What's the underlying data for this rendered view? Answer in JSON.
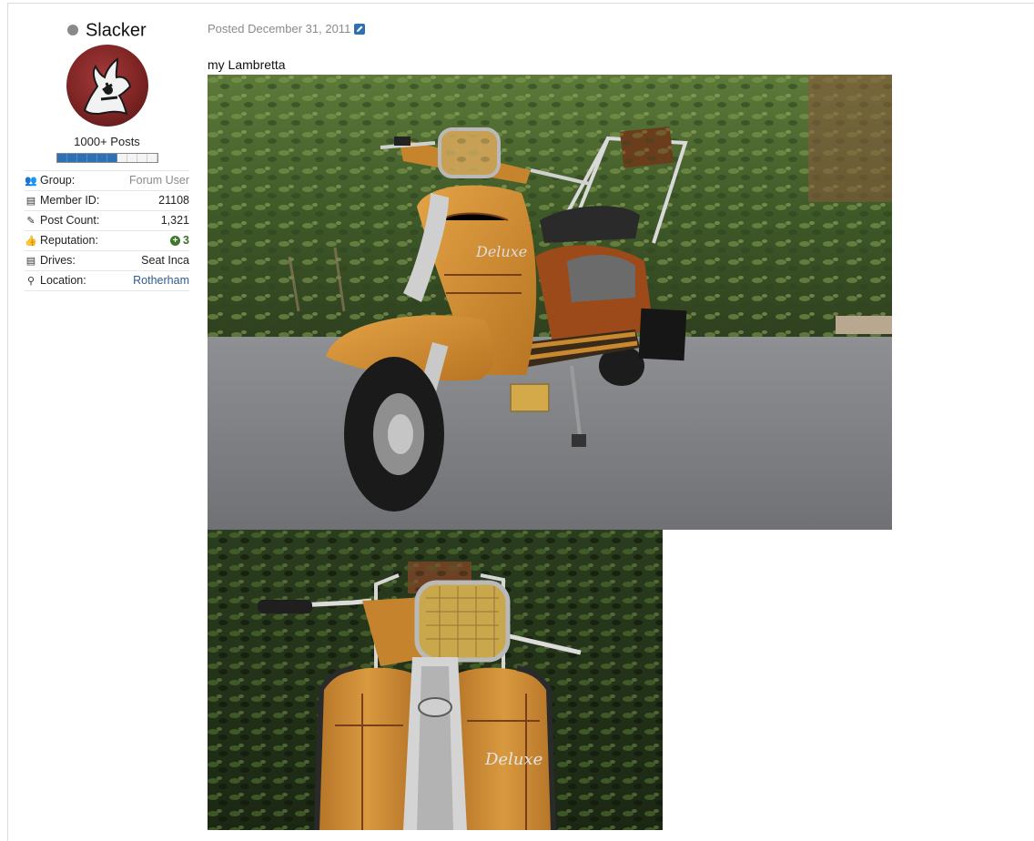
{
  "author": {
    "name": "Slacker",
    "status": "offline",
    "rank_label": "1000+ Posts",
    "rank_progress": 0.6,
    "info": [
      {
        "icon": "users-icon",
        "glyph": "👥",
        "key": "Group:",
        "value": "Forum User",
        "style": "muted"
      },
      {
        "icon": "id-card-icon",
        "glyph": "▤",
        "key": "Member ID:",
        "value": "21108",
        "style": "plain"
      },
      {
        "icon": "edit-icon",
        "glyph": "✎",
        "key": "Post Count:",
        "value": "1,321",
        "style": "plain"
      },
      {
        "icon": "thumbs-up-icon",
        "glyph": "👍",
        "key": "Reputation:",
        "value": "3",
        "style": "rep"
      },
      {
        "icon": "id-card-icon",
        "glyph": "▤",
        "key": "Drives:",
        "value": "Seat Inca",
        "style": "plain"
      },
      {
        "icon": "map-marker-icon",
        "glyph": "⚲",
        "key": "Location:",
        "value": "Rotherham",
        "style": "link"
      }
    ]
  },
  "post": {
    "date": "Posted December 31, 2011",
    "text": "my Lambretta",
    "images": [
      {
        "name": "lambretta-photo-side-view"
      },
      {
        "name": "lambretta-photo-front-view"
      }
    ]
  },
  "colors": {
    "link": "#2f5a8f",
    "muted": "#8a8a8a",
    "accent": "#2f6fb4",
    "reputation": "#3d6e27"
  }
}
